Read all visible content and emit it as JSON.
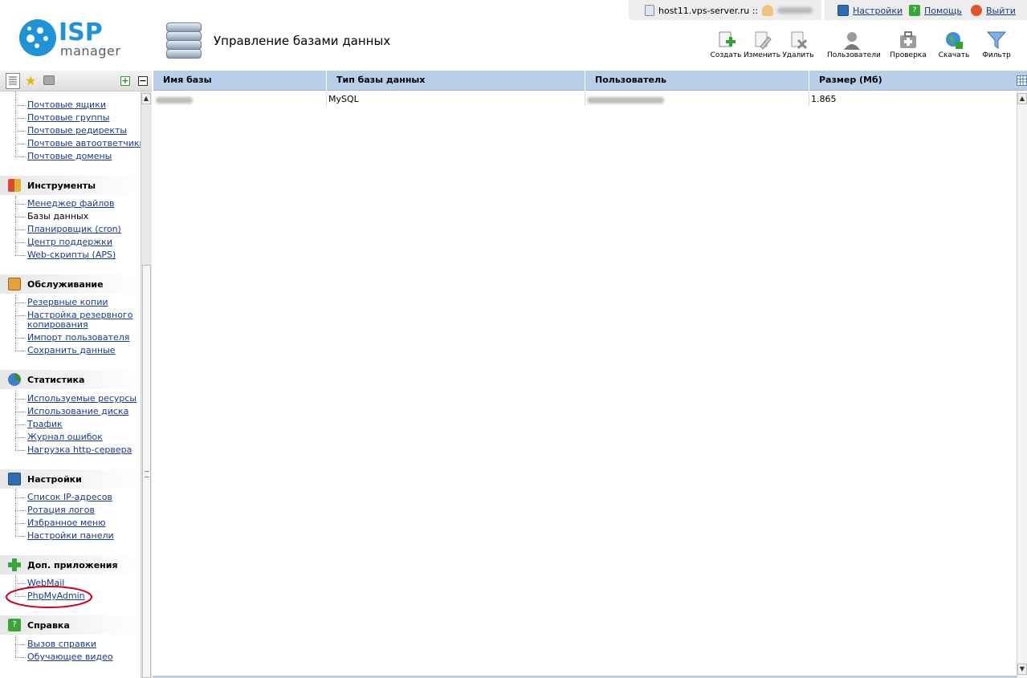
{
  "header": {
    "logo_isp": "ISP",
    "logo_manager": "manager",
    "page_title": "Управление базами данных",
    "server_name": "host11.vps-server.ru ::",
    "links": {
      "settings": "Настройки",
      "help": "Помощь",
      "logout": "Выйти"
    }
  },
  "toolbar": {
    "create": "Создать",
    "edit": "Изменить",
    "delete": "Удалить",
    "users": "Пользователи",
    "check": "Проверка",
    "download": "Скачать",
    "filter": "Фильтр"
  },
  "sidebar": {
    "mail_items": [
      "Почтовые ящики",
      "Почтовые группы",
      "Почтовые редиректы",
      "Почтовые автоответчики",
      "Почтовые домены"
    ],
    "sections": [
      {
        "title": "Инструменты",
        "items": [
          "Менеджер файлов",
          "Базы данных",
          "Планировщик (cron)",
          "Центр поддержки",
          "Web-скрипты (APS)"
        ]
      },
      {
        "title": "Обслуживание",
        "items": [
          "Резервные копии",
          "Настройка резервного копирования",
          "Импорт пользователя",
          "Сохранить данные"
        ]
      },
      {
        "title": "Статистика",
        "items": [
          "Используемые ресурсы",
          "Использование диска",
          "Трафик",
          "Журнал ошибок",
          "Нагрузка http-сервера"
        ]
      },
      {
        "title": "Настройки",
        "items": [
          "Список IP-адресов",
          "Ротация логов",
          "Избранное меню",
          "Настройки панели"
        ]
      },
      {
        "title": "Доп. приложения",
        "items": [
          "WebMail",
          "PhpMyAdmin"
        ]
      },
      {
        "title": "Справка",
        "items": [
          "Вызов справки",
          "Обучающее видео"
        ]
      }
    ],
    "backup_line1": "Настройка резервного",
    "backup_line2": "копирования"
  },
  "table": {
    "columns": [
      "Имя базы",
      "Тип базы данных",
      "Пользователь",
      "Размер (Мб)"
    ],
    "rows": [
      {
        "type": "MySQL",
        "size": "1.865"
      }
    ]
  },
  "colors": {
    "accent": "#1f93d6",
    "table_header": "#b7cfe9",
    "link": "#1a3a8a",
    "highlight_ellipse": "#d0021b"
  }
}
